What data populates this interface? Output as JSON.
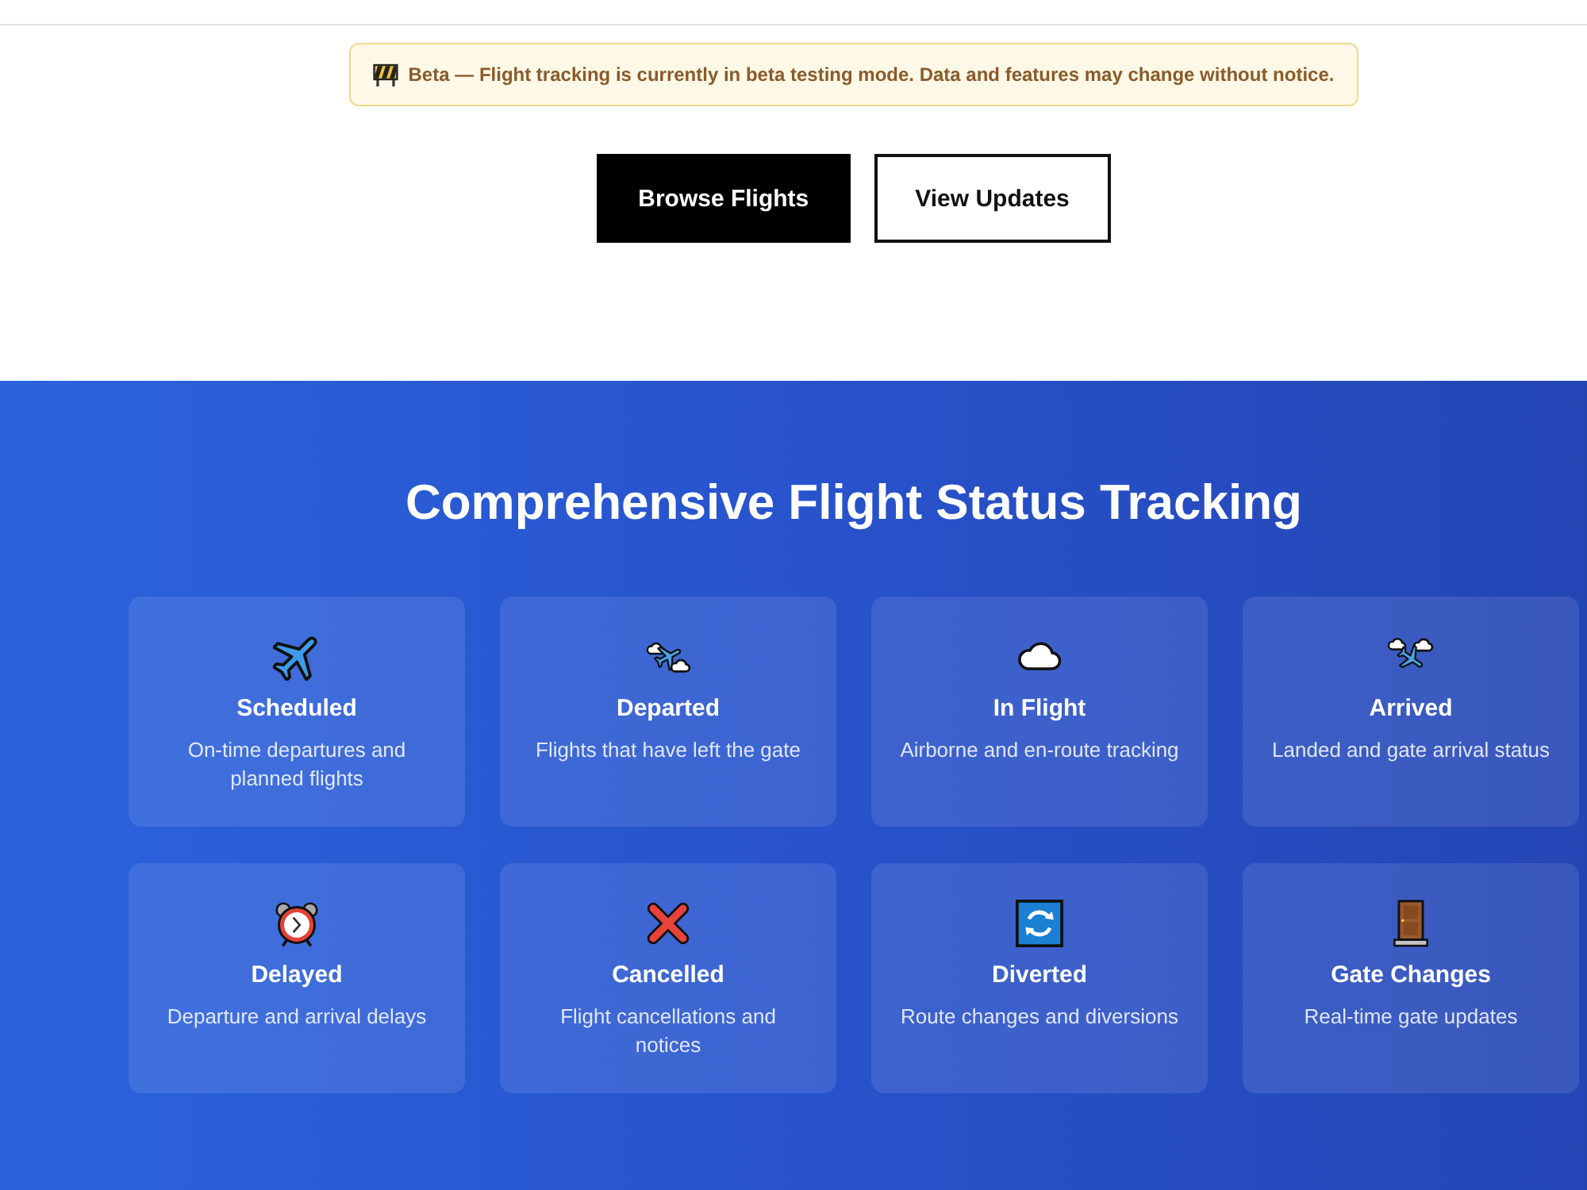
{
  "notice": {
    "text": "Beta — Flight tracking is currently in beta testing mode. Data and features may change without notice."
  },
  "actions": [
    {
      "label": "Browse Flights",
      "kind": "primary"
    },
    {
      "label": "View Updates",
      "kind": "secondary"
    }
  ],
  "features": {
    "title": "Comprehensive Flight Status Tracking",
    "cards": [
      {
        "title": "Scheduled",
        "description": "On-time departures and planned flights"
      },
      {
        "title": "Departed",
        "description": "Flights that have left the gate"
      },
      {
        "title": "In Flight",
        "description": "Airborne and en-route tracking"
      },
      {
        "title": "Arrived",
        "description": "Landed and gate arrival status"
      },
      {
        "title": "Delayed",
        "description": "Departure and arrival delays"
      },
      {
        "title": "Cancelled",
        "description": "Flight cancellations and notices"
      },
      {
        "title": "Diverted",
        "description": "Route changes and diversions"
      },
      {
        "title": "Gate Changes",
        "description": "Real-time gate updates"
      }
    ]
  }
}
